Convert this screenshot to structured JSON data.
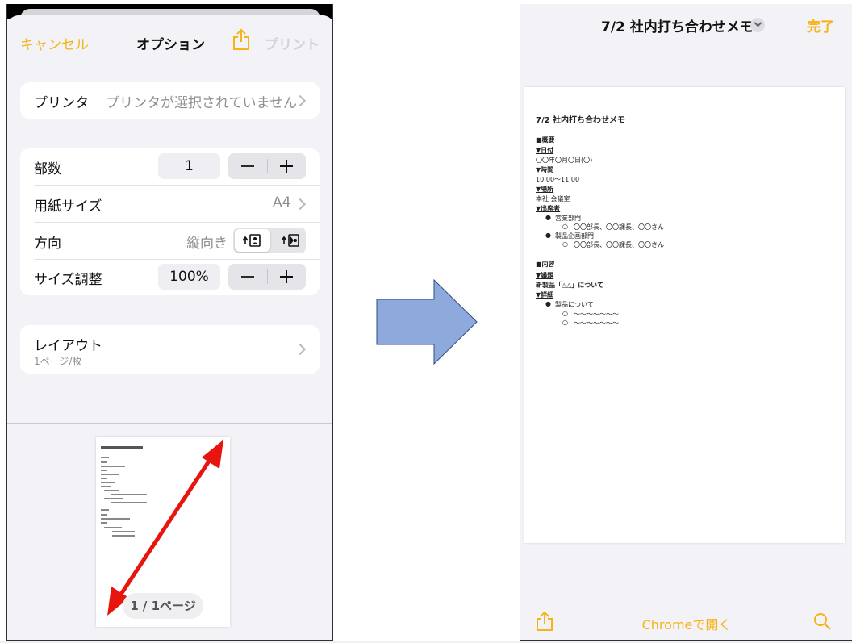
{
  "print_options": {
    "cancel_label": "キャンセル",
    "title": "オプション",
    "print_label": "プリント",
    "printer": {
      "label": "プリンタ",
      "value": "プリンタが選択されていません"
    },
    "copies": {
      "label": "部数",
      "value": "1"
    },
    "paper_size": {
      "label": "用紙サイズ",
      "value": "A4"
    },
    "orientation": {
      "label": "方向",
      "value": "縦向き"
    },
    "scaling": {
      "label": "サイズ調整",
      "value": "100%"
    },
    "layout": {
      "label": "レイアウト",
      "sub": "1ページ/枚"
    },
    "page_indicator": "1 / 1ページ"
  },
  "viewer": {
    "title": "7/2 社内打ち合わせメモ",
    "done_label": "完了",
    "open_in_chrome": "Chromeで開く"
  },
  "document": {
    "title": "7/2 社内打ち合わせメモ",
    "lines": [
      "■概要",
      "▼日付",
      "〇〇年〇月〇日(〇)",
      "▼時間",
      "10:00～11:00",
      "▼場所",
      "本社 会議室",
      "▼出席者",
      "営業部門",
      "〇〇部長、〇〇課長、〇〇さん",
      "製品企画部門",
      "〇〇部長、〇〇課長、〇〇さん",
      "■内容",
      "▼議題",
      "新製品「△△」について",
      "▼詳細",
      "製品について",
      "～～～～～～～",
      "～～～～～～～"
    ],
    "bullet_filled": "●",
    "bullet_open": "○"
  },
  "colors": {
    "accent": "#f6b417",
    "arrow_red": "#e8150e",
    "arrow_blue": "#8ea9db",
    "arrow_blue_border": "#2f4e80"
  },
  "icons": {
    "share": "share-icon",
    "chevron": "chevron-right-icon",
    "search": "search-icon",
    "portrait": "portrait-orientation-icon",
    "landscape": "landscape-orientation-icon"
  }
}
